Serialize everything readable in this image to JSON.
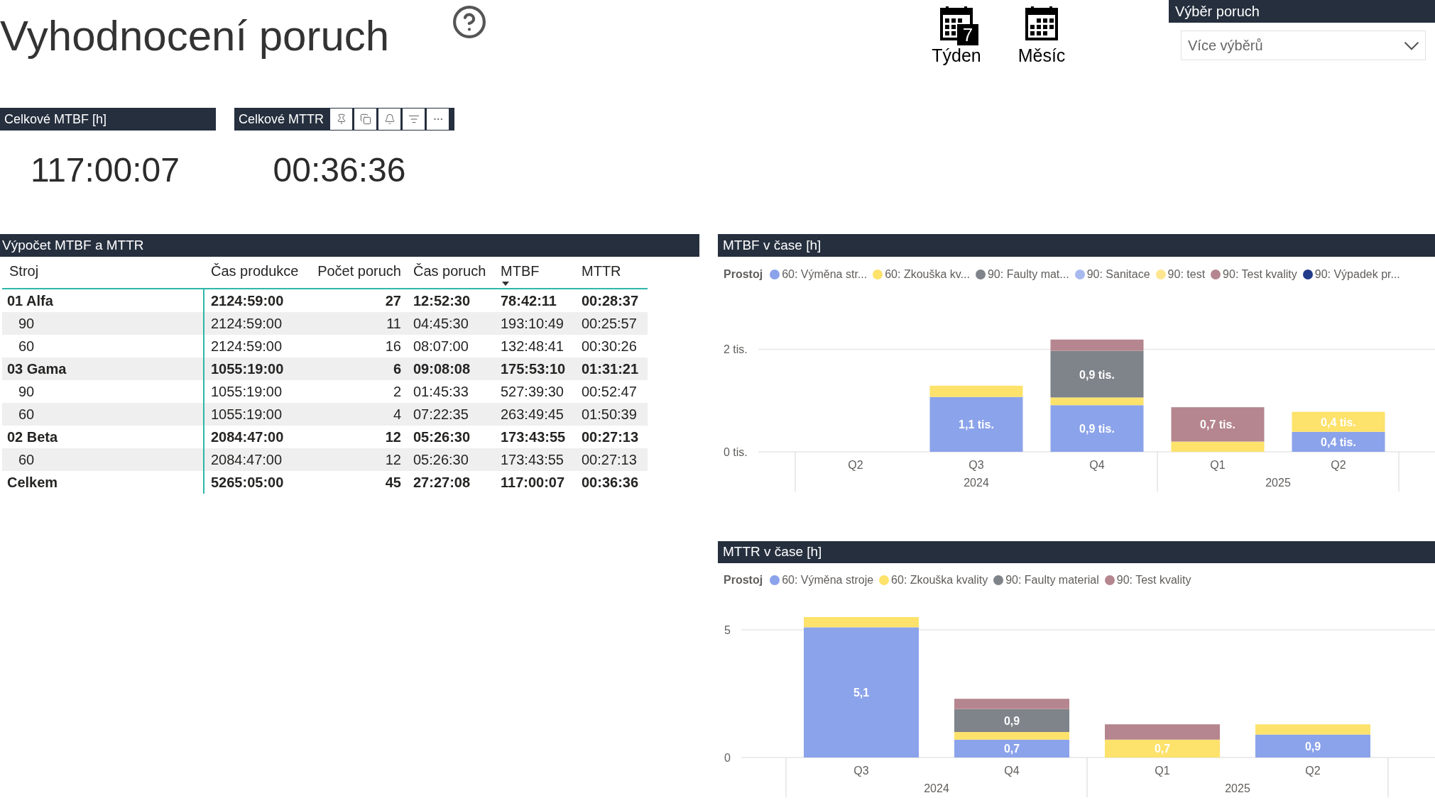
{
  "page": {
    "title": "Vyhodnocení poruch"
  },
  "period_buttons": [
    {
      "label": "Týden",
      "badge": "7"
    },
    {
      "label": "Měsíc"
    }
  ],
  "slicer": {
    "title": "Výběr poruch",
    "value": "Více výběrů"
  },
  "kpi_cards": [
    {
      "title": "Celkové MTBF [h]",
      "value": "117:00:07",
      "hovered": false
    },
    {
      "title": "Celkové MTTR",
      "value": "00:36:36",
      "hovered": true
    }
  ],
  "table": {
    "title": "Výpočet MTBF a MTTR",
    "columns": [
      {
        "label": "Stroj",
        "kind": "name",
        "sorted": false
      },
      {
        "label": "Čas produkce",
        "kind": "time",
        "sorted": false
      },
      {
        "label": "Počet poruch",
        "kind": "count",
        "sorted": false
      },
      {
        "label": "Čas poruch",
        "kind": "time",
        "sorted": false
      },
      {
        "label": "MTBF",
        "kind": "time",
        "sorted": true
      },
      {
        "label": "MTTR",
        "kind": "time",
        "sorted": false
      }
    ],
    "rows": [
      {
        "cells": [
          "01 Alfa",
          "2124:59:00",
          "27",
          "12:52:30",
          "78:42:11",
          "00:28:37"
        ],
        "children": [
          {
            "cells": [
              "90",
              "2124:59:00",
              "11",
              "04:45:30",
              "193:10:49",
              "00:25:57"
            ]
          },
          {
            "cells": [
              "60",
              "2124:59:00",
              "16",
              "08:07:00",
              "132:48:41",
              "00:30:26"
            ]
          }
        ]
      },
      {
        "cells": [
          "03 Gama",
          "1055:19:00",
          "6",
          "09:08:08",
          "175:53:10",
          "01:31:21"
        ],
        "children": [
          {
            "cells": [
              "90",
              "1055:19:00",
              "2",
              "01:45:33",
              "527:39:30",
              "00:52:47"
            ]
          },
          {
            "cells": [
              "60",
              "1055:19:00",
              "4",
              "07:22:35",
              "263:49:45",
              "01:50:39"
            ]
          }
        ]
      },
      {
        "cells": [
          "02 Beta",
          "2084:47:00",
          "12",
          "05:26:30",
          "173:43:55",
          "00:27:13"
        ],
        "children": [
          {
            "cells": [
              "60",
              "2084:47:00",
              "12",
              "05:26:30",
              "173:43:55",
              "00:27:13"
            ]
          }
        ]
      }
    ],
    "total_row": {
      "cells": [
        "Celkem",
        "5265:05:00",
        "45",
        "27:27:08",
        "117:00:07",
        "00:36:36"
      ]
    }
  },
  "charts": [
    {
      "title": "MTBF v čase [h]",
      "x_groups": [
        {
          "label": "2024"
        },
        {
          "label": "2025"
        }
      ],
      "chart_data": {
        "type": "bar",
        "stacked": true,
        "orientation": "vertical",
        "legend": {
          "title": "Prostoj"
        },
        "categories": [
          "Q2",
          "Q3",
          "Q4",
          "Q1",
          "Q2"
        ],
        "ylim": [
          0,
          2.2
        ],
        "yticks": [
          {
            "value": 0,
            "label": "0 tis."
          },
          {
            "value": 2,
            "label": "2 tis."
          }
        ],
        "series": [
          {
            "name": "60: Výměna str...",
            "color": "#8ba3ea",
            "values": [
              null,
              1.07,
              0.91,
              null,
              0.39
            ],
            "value_labels": [
              null,
              "1,1 tis.",
              "0,9 tis.",
              null,
              "0,4 tis."
            ]
          },
          {
            "name": "60: Zkouška kv...",
            "color": "#fde26b",
            "values": [
              null,
              0.22,
              0.15,
              0.2,
              0.39
            ],
            "value_labels": [
              null,
              null,
              null,
              null,
              "0,4 tis."
            ]
          },
          {
            "name": "90: Faulty mat...",
            "color": "#7f838a",
            "values": [
              null,
              null,
              0.91,
              null,
              null
            ],
            "value_labels": [
              null,
              null,
              "0,9 tis.",
              null,
              null
            ]
          },
          {
            "name": "90: Sanitace",
            "color": "#a8b9ef",
            "values": [
              null,
              null,
              null,
              null,
              null
            ]
          },
          {
            "name": "90: test",
            "color": "#fee690",
            "values": [
              null,
              null,
              null,
              null,
              null
            ]
          },
          {
            "name": "90: Test kvality",
            "color": "#b5868f",
            "values": [
              null,
              null,
              0.22,
              0.67,
              null
            ],
            "value_labels": [
              null,
              null,
              null,
              "0,7 tis.",
              null
            ]
          },
          {
            "name": "90: Výpadek pr...",
            "color": "#233b8b",
            "values": [
              null,
              null,
              null,
              null,
              null
            ]
          }
        ]
      }
    },
    {
      "title": "MTTR v čase [h]",
      "x_groups": [
        {
          "label": "2024"
        },
        {
          "label": "2025"
        }
      ],
      "chart_data": {
        "type": "bar",
        "stacked": true,
        "orientation": "vertical",
        "legend": {
          "title": "Prostoj"
        },
        "categories": [
          "Q3",
          "Q4",
          "Q1",
          "Q2"
        ],
        "ylim": [
          0,
          5.5
        ],
        "yticks": [
          0,
          5
        ],
        "series": [
          {
            "name": "60: Výměna stroje",
            "color": "#8ba3ea",
            "values": [
              5.1,
              0.7,
              null,
              0.9
            ],
            "value_labels": [
              "5,1",
              "0,7",
              null,
              "0,9"
            ]
          },
          {
            "name": "60: Zkouška kvality",
            "color": "#fde26b",
            "values": [
              0.4,
              0.3,
              0.7,
              0.4
            ],
            "value_labels": [
              null,
              null,
              "0,7",
              null
            ]
          },
          {
            "name": "90: Faulty material",
            "color": "#7f838a",
            "values": [
              null,
              0.9,
              null,
              null
            ],
            "value_labels": [
              null,
              "0,9",
              null,
              null
            ]
          },
          {
            "name": "90: Test kvality",
            "color": "#b5868f",
            "values": [
              null,
              0.4,
              0.6,
              null
            ]
          }
        ]
      }
    }
  ]
}
